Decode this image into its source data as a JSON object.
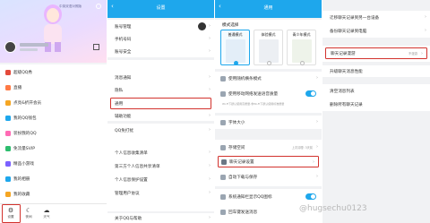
{
  "panel1": {
    "hero_text": "中英双语对照版",
    "menu": [
      {
        "label": "超级QQ秀",
        "color": "#e44a3b"
      },
      {
        "label": "直播",
        "color": "#ff7a45"
      },
      {
        "label": "点亮&折开会员",
        "color": "#f5a623"
      },
      {
        "label": "我的QQ钱包",
        "color": "#1ea7ec"
      },
      {
        "label": "装扮我的QQ",
        "color": "#ff6bb5"
      },
      {
        "label": "免流量SVIP",
        "color": "#2dbd6e"
      },
      {
        "label": "精品小游戏",
        "color": "#7b61ff"
      },
      {
        "label": "我的相册",
        "color": "#1ea7ec"
      },
      {
        "label": "我的收藏",
        "color": "#f5a623"
      }
    ],
    "tabs": [
      "设置",
      "夜间",
      "天气"
    ]
  },
  "panel2": {
    "title": "设置",
    "items": [
      "账号管理",
      "手机号码",
      "账号安全",
      "消息通知",
      "隐私",
      "通用",
      "辅助功能",
      "QQ免打扰",
      "个人信息收集清单",
      "第三方个人信息共享清单",
      "个人信息保护设置",
      "管理用户协议",
      "关于QQ与帮助"
    ]
  },
  "panel3": {
    "title": "通用",
    "mode_header": "模式选择",
    "modes": [
      "普通模式",
      "体验模式",
      "青少年模式"
    ],
    "items_a": [
      "使用随机横条模式",
      "使用移动网络发送语音质量"
    ],
    "note": "Wi-Fi下默认使用高质量,非Wi-Fi下默认使用标准质量",
    "items_b": [
      "字体大小"
    ],
    "items_c": [
      "存储空间",
      "聊天记录设置",
      "自动下载与保存"
    ],
    "storage_hint": "上次清理: 3天前",
    "items_d": [
      "系统通知栏显示QQ图标",
      "回车键发送消息"
    ]
  },
  "panel4": {
    "items": [
      "迁移聊天记录到另一台设备",
      "备份聊天记录到电脑",
      "聊天记录漫游",
      "升级聊天消息性能",
      "清空消息列表",
      "删除所有聊天记录"
    ],
    "roaming_value": "不漫游"
  },
  "watermark": "@hugsechu0123"
}
